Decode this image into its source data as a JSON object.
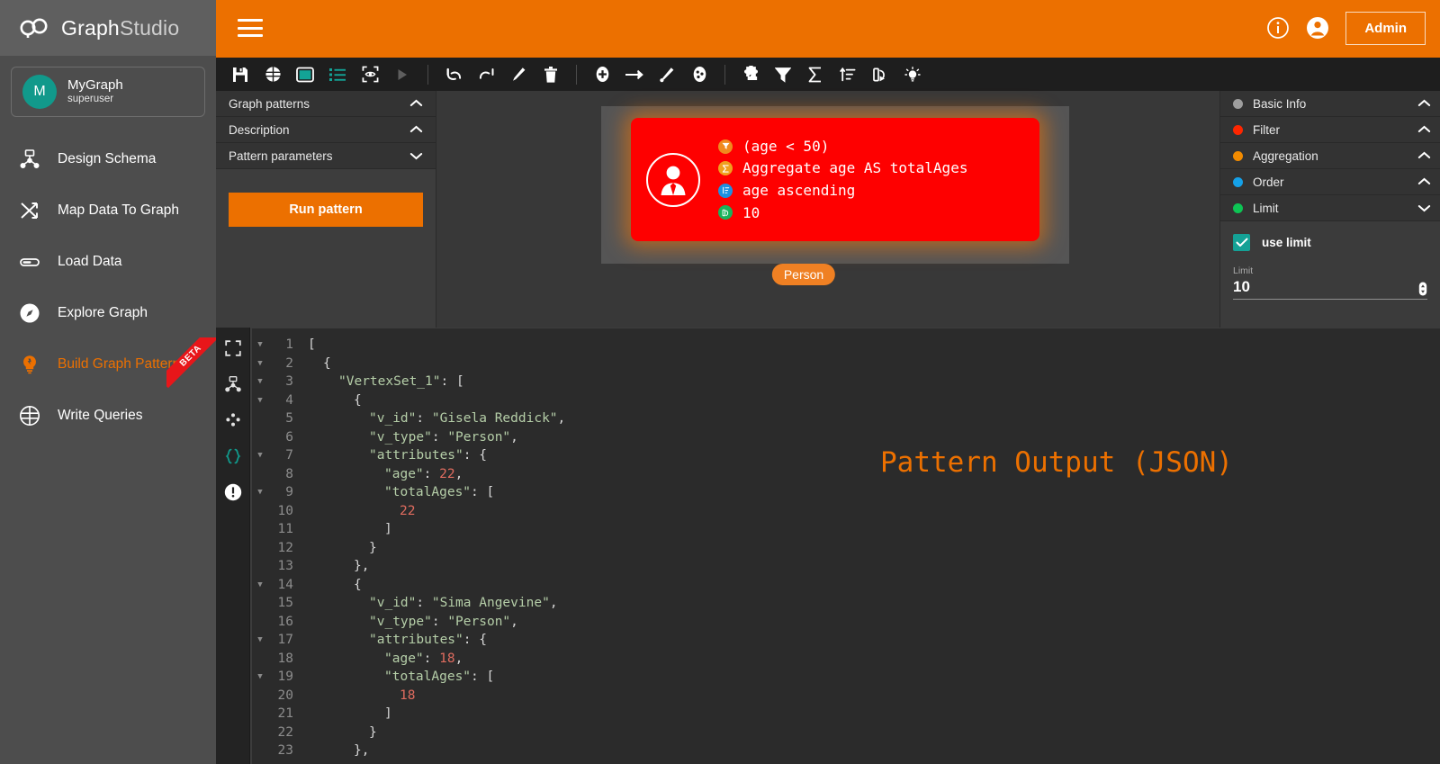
{
  "brand": {
    "title_bold": "Graph",
    "title_light": "Studio",
    "logo_icon": "infinity-logo-icon"
  },
  "topbar": {
    "menu_icon": "hamburger-menu-icon",
    "info_icon": "info-circle-icon",
    "account_icon": "account-circle-icon",
    "admin_label": "Admin"
  },
  "sidebar": {
    "graph": {
      "avatar_letter": "M",
      "name": "MyGraph",
      "role": "superuser"
    },
    "items": [
      {
        "label": "Design Schema",
        "icon": "schema-icon",
        "active": false,
        "beta": false
      },
      {
        "label": "Map Data To Graph",
        "icon": "shuffle-icon",
        "active": false,
        "beta": false
      },
      {
        "label": "Load Data",
        "icon": "load-icon",
        "active": false,
        "beta": false
      },
      {
        "label": "Explore Graph",
        "icon": "compass-icon",
        "active": false,
        "beta": false
      },
      {
        "label": "Build Graph Patterns",
        "icon": "bulb-icon",
        "active": true,
        "beta": true,
        "beta_label": "BETA"
      },
      {
        "label": "Write Queries",
        "icon": "gsql-icon",
        "active": false,
        "beta": false
      }
    ]
  },
  "toolbar": {
    "groups": [
      [
        "save-icon",
        "gsql-globe-icon",
        "canvas-view-icon",
        "list-view-icon",
        "focus-eye-icon",
        "play-icon"
      ],
      [
        "undo-icon",
        "redo-icon",
        "edit-pencil-icon",
        "delete-trash-icon"
      ],
      [
        "add-vertex-icon",
        "add-edge-icon",
        "draw-edge-icon",
        "add-accum-icon"
      ],
      [
        "puzzle-icon",
        "filter-icon",
        "sigma-aggregate-icon",
        "order-icon",
        "limit-icon",
        "hint-bulb-icon"
      ]
    ]
  },
  "pattern_panel": {
    "sections": [
      {
        "label": "Graph patterns",
        "chevron": "chevron-up-icon"
      },
      {
        "label": "Description",
        "chevron": "chevron-up-icon"
      },
      {
        "label": "Pattern parameters",
        "chevron": "chevron-down-icon"
      }
    ],
    "run_label": "Run pattern"
  },
  "canvas": {
    "node": {
      "avatar_icon": "person-avatar-icon",
      "label": "Person",
      "lines": [
        {
          "badge": "filter-icon",
          "badge_color": "#f08a1e",
          "badge_glyph": "▼",
          "text": "(age < 50)"
        },
        {
          "badge": "aggregate-icon",
          "badge_color": "#f0a01e",
          "badge_glyph": "Σ",
          "text": "Aggregate age AS totalAges"
        },
        {
          "badge": "order-icon",
          "badge_color": "#1e90e0",
          "badge_glyph": "≡",
          "text": "age ascending"
        },
        {
          "badge": "limit-icon",
          "badge_color": "#18b35a",
          "badge_glyph": "→",
          "text": "10"
        }
      ]
    }
  },
  "right_panel": {
    "sections": [
      {
        "label": "Basic Info",
        "color": "#9e9e9e",
        "chevron": "chevron-up-icon"
      },
      {
        "label": "Filter",
        "color": "#fe2600",
        "chevron": "chevron-up-icon"
      },
      {
        "label": "Aggregation",
        "color": "#f28b00",
        "chevron": "chevron-up-icon"
      },
      {
        "label": "Order",
        "color": "#15a1e8",
        "chevron": "chevron-up-icon"
      },
      {
        "label": "Limit",
        "color": "#0dc454",
        "chevron": "chevron-down-icon"
      }
    ],
    "limit": {
      "checkbox_label": "use limit",
      "checkbox_checked": true,
      "field_label": "Limit",
      "field_value": "10",
      "spinner_icon": "number-spinner-icon"
    }
  },
  "editor": {
    "rail": [
      "fullscreen-icon",
      "graph-view-icon",
      "scatter-view-icon",
      "json-view-icon",
      "alert-icon"
    ],
    "active_rail": "json-view-icon",
    "watermark": "Pattern Output (JSON)",
    "lines": [
      {
        "n": 1,
        "fold": true,
        "indent": 0,
        "text": "["
      },
      {
        "n": 2,
        "fold": true,
        "indent": 1,
        "text": "{"
      },
      {
        "n": 3,
        "fold": true,
        "indent": 2,
        "text": "\"VertexSet_1\": ["
      },
      {
        "n": 4,
        "fold": true,
        "indent": 3,
        "text": "{"
      },
      {
        "n": 5,
        "fold": false,
        "indent": 4,
        "text": "\"v_id\": \"Gisela Reddick\","
      },
      {
        "n": 6,
        "fold": false,
        "indent": 4,
        "text": "\"v_type\": \"Person\","
      },
      {
        "n": 7,
        "fold": true,
        "indent": 4,
        "text": "\"attributes\": {"
      },
      {
        "n": 8,
        "fold": false,
        "indent": 5,
        "text": "\"age\": 22,"
      },
      {
        "n": 9,
        "fold": true,
        "indent": 5,
        "text": "\"totalAges\": ["
      },
      {
        "n": 10,
        "fold": false,
        "indent": 6,
        "text": "22"
      },
      {
        "n": 11,
        "fold": false,
        "indent": 5,
        "text": "]"
      },
      {
        "n": 12,
        "fold": false,
        "indent": 4,
        "text": "}"
      },
      {
        "n": 13,
        "fold": false,
        "indent": 3,
        "text": "},"
      },
      {
        "n": 14,
        "fold": true,
        "indent": 3,
        "text": "{"
      },
      {
        "n": 15,
        "fold": false,
        "indent": 4,
        "text": "\"v_id\": \"Sima Angevine\","
      },
      {
        "n": 16,
        "fold": false,
        "indent": 4,
        "text": "\"v_type\": \"Person\","
      },
      {
        "n": 17,
        "fold": true,
        "indent": 4,
        "text": "\"attributes\": {"
      },
      {
        "n": 18,
        "fold": false,
        "indent": 5,
        "text": "\"age\": 18,"
      },
      {
        "n": 19,
        "fold": true,
        "indent": 5,
        "text": "\"totalAges\": ["
      },
      {
        "n": 20,
        "fold": false,
        "indent": 6,
        "text": "18"
      },
      {
        "n": 21,
        "fold": false,
        "indent": 5,
        "text": "]"
      },
      {
        "n": 22,
        "fold": false,
        "indent": 4,
        "text": "}"
      },
      {
        "n": 23,
        "fold": false,
        "indent": 3,
        "text": "},"
      }
    ]
  },
  "colors": {
    "brand_orange": "#ec7000",
    "sidebar_bg": "#4d4d4d",
    "header_gray": "#5f5f5f",
    "node_red": "#fe0000",
    "accent_teal": "#11998b"
  }
}
